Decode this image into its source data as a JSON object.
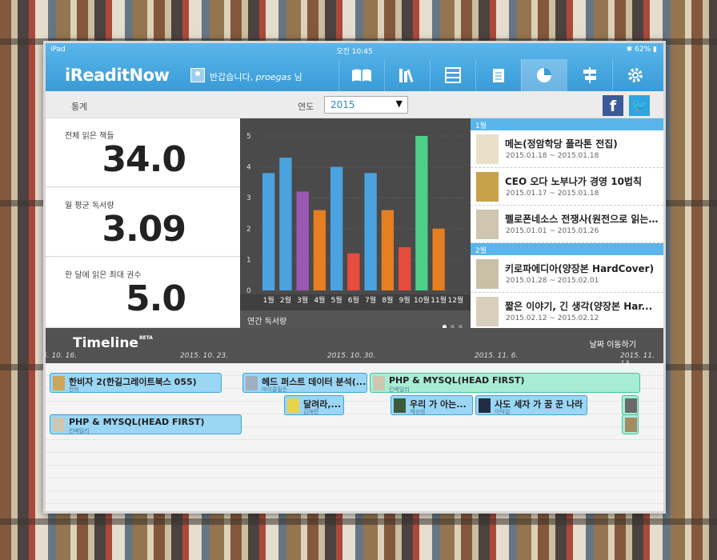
{
  "status": {
    "device": "iPad",
    "time": "오전 10:45",
    "battery": "62%"
  },
  "app": {
    "brand": "iReaditNow",
    "greeting_prefix": "반갑습니다, ",
    "username": "proegas",
    "greeting_suffix": " 님"
  },
  "nav": [
    "books-icon",
    "library-icon",
    "archive-icon",
    "notes-icon",
    "stats-icon",
    "signpost-icon",
    "settings-icon"
  ],
  "subheader": {
    "title": "통계",
    "year_label": "연도",
    "year_value": "2015"
  },
  "stats": [
    {
      "label": "전체 읽은 책들",
      "value": "34.0"
    },
    {
      "label": "월 평균 독서량",
      "value": "3.09"
    },
    {
      "label": "한 달에 읽은 최대 권수",
      "value": "5.0"
    }
  ],
  "chart_data": {
    "type": "bar",
    "title": "연간 독서량",
    "categories": [
      "1월",
      "2월",
      "3월",
      "4월",
      "5월",
      "6월",
      "7월",
      "8월",
      "9월",
      "10월",
      "11월",
      "12월"
    ],
    "values": [
      3.8,
      4.3,
      3.2,
      2.6,
      4.0,
      1.2,
      3.8,
      2.6,
      1.4,
      5.0,
      2.0,
      0
    ],
    "colors": [
      "#4aa3df",
      "#4aa3df",
      "#9b59b6",
      "#e67e22",
      "#4aa3df",
      "#e74c3c",
      "#4aa3df",
      "#e67e22",
      "#e74c3c",
      "#4cd08a",
      "#e67e22",
      "#4aa3df"
    ],
    "yticks": [
      "0",
      "1",
      "2",
      "3",
      "4",
      "5"
    ],
    "ylim": [
      0,
      5
    ]
  },
  "reading_list": {
    "months": [
      {
        "label": "1월",
        "books": [
          {
            "title": "메논(정암학당 플라톤 전집)",
            "dates": "2015.01.18 ~ 2015.01.18",
            "cover": "#e8e0c8"
          },
          {
            "title": "CEO 오다 노부나가 경영 10법칙",
            "dates": "2015.01.17 ~ 2015.01.18",
            "cover": "#c8a24a"
          },
          {
            "title": "펠로폰네소스 전쟁사(원전으로 읽는...",
            "dates": "2015.01.01 ~ 2015.01.26",
            "cover": "#cfc6b0"
          }
        ]
      },
      {
        "label": "2월",
        "books": [
          {
            "title": "키로파에디아(양장본 HardCover)",
            "dates": "2015.01.28 ~ 2015.02.01",
            "cover": "#c9c0a8"
          },
          {
            "title": "짧은 이야기, 긴 생각(양장본 Har...",
            "dates": "2015.02.12 ~ 2015.02.12",
            "cover": "#d8d0bc"
          }
        ]
      }
    ]
  },
  "timeline": {
    "title": "Timeline",
    "beta": "BETA",
    "jump": "날짜 이동하기",
    "dates": [
      "5. 10. 16.",
      "2015. 10. 23.",
      "2015. 10. 30.",
      "2015. 11. 6.",
      "2015. 11. 13."
    ],
    "bars": [
      {
        "name": "한비자 2(한길그레이트북스 055)",
        "author": "한비",
        "style": "b"
      },
      {
        "name": "헤드 퍼스트 데이터 분석(...",
        "author": "마이클밀든",
        "style": "b"
      },
      {
        "name": "PHP & MYSQL(HEAD FIRST)",
        "author": "린베일리",
        "style": "g"
      },
      {
        "name": "달려라,...",
        "author": "김애란",
        "style": "b"
      },
      {
        "name": "우리 가 아는...",
        "author": "계승범",
        "style": "b"
      },
      {
        "name": "사도 세자 가 꿈 꾼 나라",
        "author": "이덕일",
        "style": "b"
      },
      {
        "name": "PHP & MYSQL(HEAD FIRST)",
        "author": "린베일리",
        "style": "b"
      },
      {
        "name": "",
        "author": "",
        "style": "g"
      },
      {
        "name": "",
        "author": "",
        "style": "g"
      }
    ]
  }
}
